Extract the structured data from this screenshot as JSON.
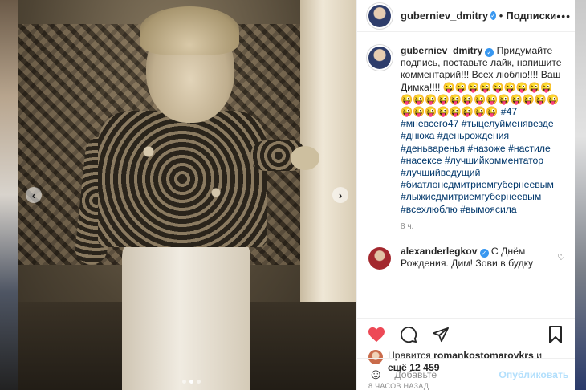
{
  "post": {
    "username": "guberniev_dmitry",
    "follow_label": "Подписки",
    "caption_text": "Придумайте подпись, поставьте лайк, напишите комментарий!!! Всех люблю!!!! Ваш Димка!!!! ",
    "caption_emojis": "😜😜😜😜😜😜😜😜😜😜😜😜😜😜😜😜😜😜😜😜😜😜😜😜😜😜😜😜😜😜",
    "hashtags": [
      "#47",
      "#мневсего47",
      "#тыцелуйменявезде",
      "#днюха",
      "#деньрождения",
      "#деньваренья",
      "#назоже",
      "#настиле",
      "#насексе",
      "#лучшийкомментатор",
      "#лучшийведущий",
      "#биатлонсдмитриемгубернеевым",
      "#лыжисдмитриемгубернеевым",
      "#всехлюблю",
      "#вымоясила"
    ],
    "caption_time": "8 ч.",
    "post_time": "8 ЧАСОВ НАЗАД"
  },
  "comment": {
    "username": "alexanderlegkov",
    "text": "С Днём Рождения. Дим! Зови в будку"
  },
  "likes": {
    "prefix": "Нравится",
    "user": "romankostomarovkrs",
    "connector": "и",
    "others": "ещё 12 459"
  },
  "compose": {
    "placeholder": "Добавьте",
    "publish_label": "Опубликовать"
  },
  "carousel": {
    "prev": "‹",
    "next": "›"
  },
  "icons": {
    "heart": "heart-icon",
    "comment": "comment-icon",
    "share": "share-icon",
    "bookmark": "bookmark-icon",
    "more": "more-icon",
    "emoji": "emoji-icon"
  },
  "colors": {
    "liked_heart": "#ed4956",
    "hashtag": "#00376b",
    "verified": "#3897f0",
    "publish_disabled": "#b2dffc"
  }
}
